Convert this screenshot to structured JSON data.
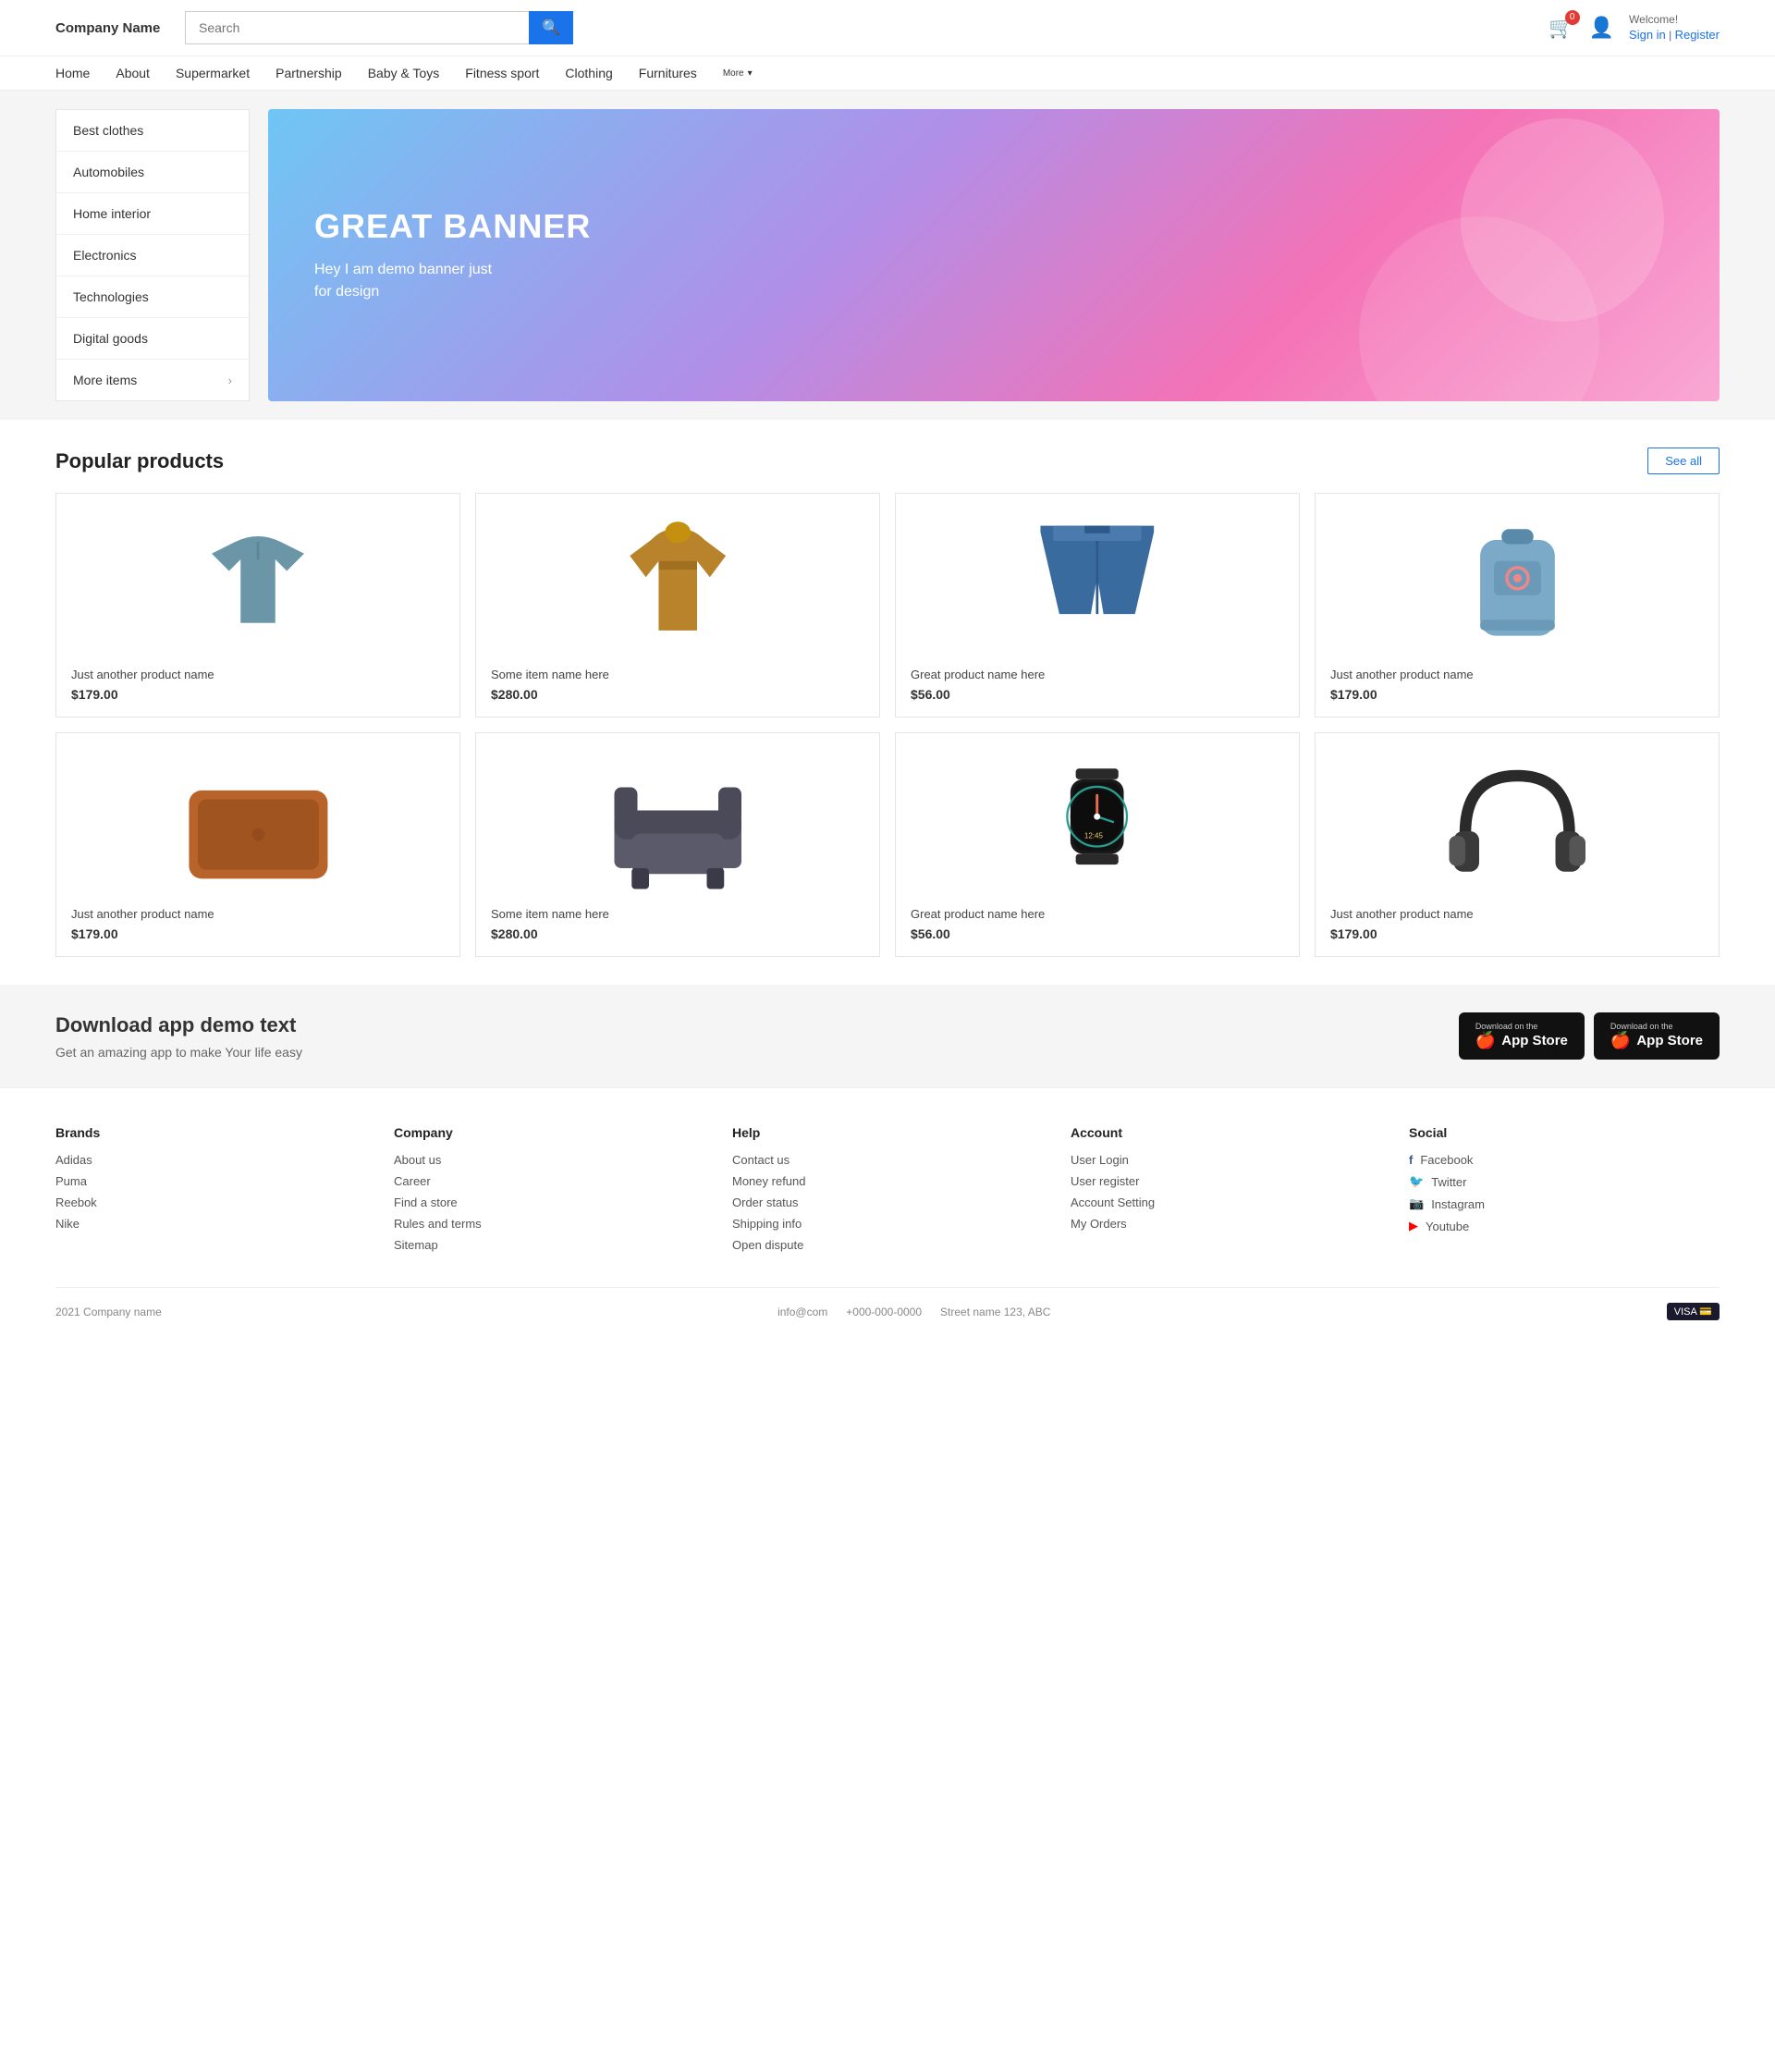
{
  "header": {
    "logo": "Company Name",
    "search_placeholder": "Search",
    "search_button_icon": "🔍",
    "cart_badge": "0",
    "welcome_text": "Welcome!",
    "sign_in_label": "Sign in",
    "register_label": "Register",
    "sign_register_separator": " | "
  },
  "nav": {
    "items": [
      {
        "label": "Home",
        "href": "#"
      },
      {
        "label": "About",
        "href": "#"
      },
      {
        "label": "Supermarket",
        "href": "#"
      },
      {
        "label": "Partnership",
        "href": "#"
      },
      {
        "label": "Baby &amp; Toys",
        "href": "#"
      },
      {
        "label": "Fitness sport",
        "href": "#"
      },
      {
        "label": "Clothing",
        "href": "#"
      },
      {
        "label": "Furnitures",
        "href": "#"
      },
      {
        "label": "More",
        "href": "#",
        "has_arrow": true
      }
    ]
  },
  "sidebar": {
    "items": [
      {
        "label": "Best clothes",
        "has_arrow": false
      },
      {
        "label": "Automobiles",
        "has_arrow": false
      },
      {
        "label": "Home interior",
        "has_arrow": false
      },
      {
        "label": "Electronics",
        "has_arrow": false
      },
      {
        "label": "Technologies",
        "has_arrow": false
      },
      {
        "label": "Digital goods",
        "has_arrow": false
      },
      {
        "label": "More items",
        "has_arrow": true
      }
    ]
  },
  "banner": {
    "title": "GREAT BANNER",
    "subtitle": "Hey I am demo banner just\nfor design"
  },
  "popular_products": {
    "section_title": "Popular products",
    "see_all_label": "See all",
    "products": [
      {
        "name": "Just another product name",
        "price": "$179.00",
        "type": "shirt"
      },
      {
        "name": "Some item name here",
        "price": "$280.00",
        "type": "jacket"
      },
      {
        "name": "Great product name here",
        "price": "$56.00",
        "type": "jeans"
      },
      {
        "name": "Just another product name",
        "price": "$179.00",
        "type": "backpack"
      },
      {
        "name": "Just another product name",
        "price": "$179.00",
        "type": "laptop"
      },
      {
        "name": "Some item name here",
        "price": "$280.00",
        "type": "chair"
      },
      {
        "name": "Great product name here",
        "price": "$56.00",
        "type": "watch"
      },
      {
        "name": "Just another product name",
        "price": "$179.00",
        "type": "headphones"
      }
    ]
  },
  "app_section": {
    "title": "Download app demo text",
    "subtitle": "Get an amazing app to make Your life easy",
    "btn1_small": "Download on the",
    "btn1_big": "App Store",
    "btn2_small": "Download on the",
    "btn2_big": "App Store"
  },
  "footer": {
    "brands": {
      "title": "Brands",
      "links": [
        "Adidas",
        "Puma",
        "Reebok",
        "Nike"
      ]
    },
    "company": {
      "title": "Company",
      "links": [
        "About us",
        "Career",
        "Find a store",
        "Rules and terms",
        "Sitemap"
      ]
    },
    "help": {
      "title": "Help",
      "links": [
        "Contact us",
        "Money refund",
        "Order status",
        "Shipping info",
        "Open dispute"
      ]
    },
    "account": {
      "title": "Account",
      "links": [
        "User Login",
        "User register",
        "Account Setting",
        "My Orders"
      ]
    },
    "social": {
      "title": "Social",
      "links": [
        {
          "label": "Facebook",
          "icon": "f"
        },
        {
          "label": "Twitter",
          "icon": "t"
        },
        {
          "label": "Instagram",
          "icon": "i"
        },
        {
          "label": "Youtube",
          "icon": "y"
        }
      ]
    },
    "bottom": {
      "copyright": "2021 Company name",
      "email": "info@com",
      "phone": "+000-000-0000",
      "address": "Street name 123, ABC"
    }
  }
}
